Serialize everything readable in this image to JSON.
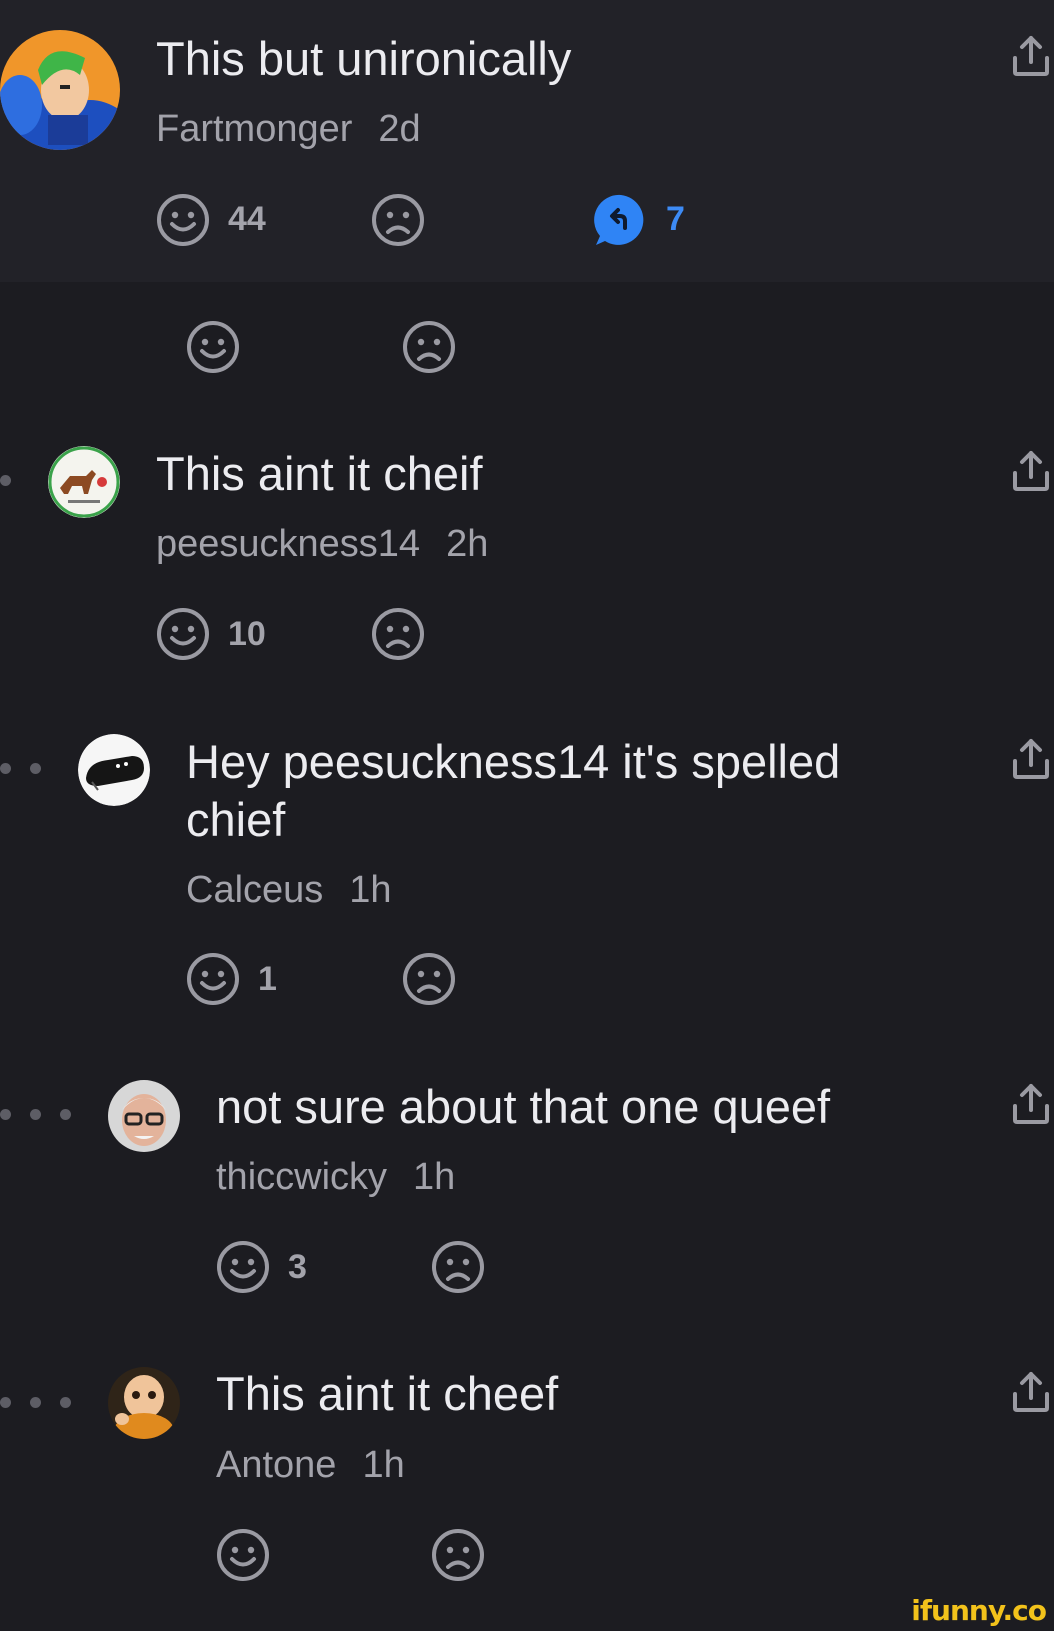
{
  "comments": [
    {
      "text": "This but unironically",
      "author": "Fartmonger",
      "time": "2d",
      "likes": "44",
      "replies": "7"
    },
    {
      "text": "",
      "author": "",
      "time": "",
      "likes": "",
      "replies": ""
    },
    {
      "text": "This aint it cheif",
      "author": "peesuckness14",
      "time": "2h",
      "likes": "10"
    },
    {
      "text": "Hey peesuckness14 it's spelled chief",
      "author": "Calceus",
      "time": "1h",
      "likes": "1"
    },
    {
      "text": "not sure about that one queef",
      "author": "thiccwicky",
      "time": "1h",
      "likes": "3"
    },
    {
      "text": "This aint it cheef",
      "author": "Antone",
      "time": "1h",
      "likes": ""
    }
  ],
  "colors": {
    "background": "#1c1c21",
    "top_comment_bg": "#222228",
    "icon_gray": "#9a9aa2",
    "reply_blue": "#3d8bf5",
    "watermark": "#f2c21b"
  },
  "icons": {
    "like": "smile-icon",
    "dislike": "frown-icon",
    "reply": "reply-bubble-icon",
    "share": "share-upload-icon"
  },
  "watermark": "ifunny.co"
}
